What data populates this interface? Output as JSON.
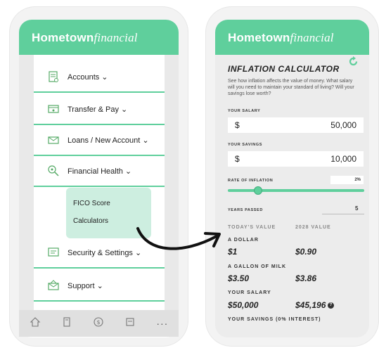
{
  "left_app": {
    "logo_bold": "Hometown",
    "logo_italic": "financial",
    "menu": [
      {
        "label": "Accounts ⌄",
        "icon": "accounts-icon"
      },
      {
        "label": "Transfer & Pay ⌄",
        "icon": "transfer-icon"
      },
      {
        "label": "Loans / New Account ⌄",
        "icon": "loans-icon"
      },
      {
        "label": "Financial Health ⌄",
        "icon": "health-icon"
      },
      {
        "label": "Security & Settings ⌄",
        "icon": "security-icon"
      },
      {
        "label": "Support ⌄",
        "icon": "support-icon"
      }
    ],
    "submenu": [
      "FICO Score",
      "Calculators"
    ],
    "tabbar": [
      "home-icon",
      "deposit-icon",
      "transfer-icon",
      "bill-pay-icon",
      "more-icon"
    ],
    "more_label": "···"
  },
  "right_app": {
    "logo_bold": "Hometown",
    "logo_italic": "financial",
    "title": "INFLATION CALCULATOR",
    "description": "See how inflation affects the value of money. What salary will you need to maintain your standard of living? Will your savings lose worth?",
    "salary_label": "YOUR SALARY",
    "salary_currency": "$",
    "salary_value": "50,000",
    "savings_label": "YOUR SAVINGS",
    "savings_currency": "$",
    "savings_value": "10,000",
    "inflation_label": "RATE OF INFLATION",
    "inflation_value": "2%",
    "inflation_fraction": 0.22,
    "years_label": "YEARS PASSED",
    "years_value": "5",
    "today_header": "TODAY'S VALUE",
    "future_header": "2028 VALUE",
    "rows": [
      {
        "label": "A DOLLAR",
        "today": "$1",
        "future": "$0.90"
      },
      {
        "label": "A GALLON OF MILK",
        "today": "$3.50",
        "future": "$3.86"
      },
      {
        "label": "YOUR SALARY",
        "today": "$50,000",
        "future": "$45,196"
      }
    ],
    "savings_row_label": "YOUR SAVINGS (0% INTEREST)",
    "help_glyph": "?"
  },
  "colors": {
    "brand_green": "#5fcf9c",
    "submenu_bg": "#cdeee0"
  }
}
